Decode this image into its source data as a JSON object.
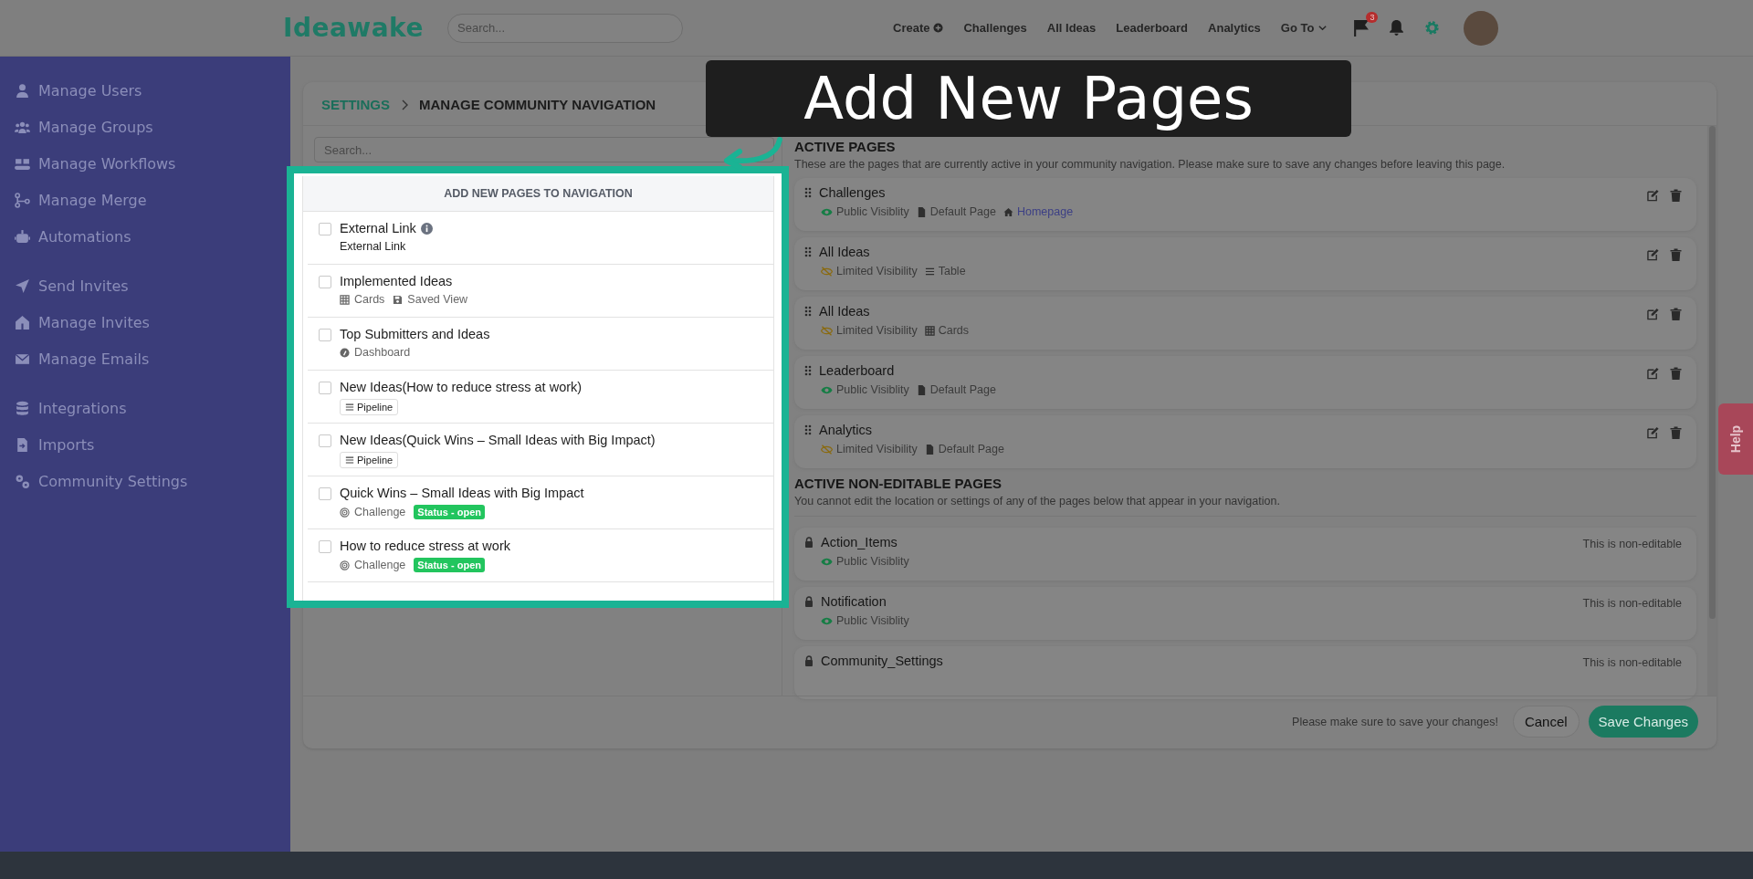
{
  "header": {
    "logo": "Ideawake",
    "search_placeholder": "Search...",
    "nav": [
      {
        "label": "Create",
        "kind": "create"
      },
      {
        "label": "Challenges",
        "kind": "link"
      },
      {
        "label": "All Ideas",
        "kind": "link"
      },
      {
        "label": "Leaderboard",
        "kind": "link"
      },
      {
        "label": "Analytics",
        "kind": "link"
      },
      {
        "label": "Go To",
        "kind": "dropdown"
      }
    ],
    "flag_badge": "3"
  },
  "sidebar": {
    "groups": [
      {
        "items": [
          {
            "label": "Manage Users"
          },
          {
            "label": "Manage Groups"
          },
          {
            "label": "Manage Workflows"
          },
          {
            "label": "Manage Merge"
          },
          {
            "label": "Automations"
          }
        ]
      },
      {
        "items": [
          {
            "label": "Send Invites"
          },
          {
            "label": "Manage Invites"
          },
          {
            "label": "Manage Emails"
          }
        ]
      },
      {
        "items": [
          {
            "label": "Integrations"
          },
          {
            "label": "Imports"
          },
          {
            "label": "Community Settings"
          }
        ]
      }
    ]
  },
  "breadcrumb": {
    "parent": "SETTINGS",
    "current": "MANAGE COMMUNITY NAVIGATION"
  },
  "add_pages": {
    "search_placeholder": "Search...",
    "title": "ADD NEW PAGES TO NAVIGATION",
    "items": [
      {
        "title": "External Link",
        "info": true,
        "checked": false,
        "meta": [
          {
            "kind": "text",
            "label": "External Link"
          }
        ]
      },
      {
        "title": "Implemented Ideas",
        "info": false,
        "checked": false,
        "meta": [
          {
            "kind": "cards",
            "label": "Cards"
          },
          {
            "kind": "saved-view",
            "label": "Saved View"
          }
        ]
      },
      {
        "title": "Top Submitters and Ideas",
        "info": false,
        "checked": false,
        "meta": [
          {
            "kind": "dashboard",
            "label": "Dashboard"
          }
        ]
      },
      {
        "title": "New Ideas(How to reduce stress at work)",
        "info": false,
        "checked": false,
        "meta": [
          {
            "kind": "pipeline",
            "label": "Pipeline"
          }
        ]
      },
      {
        "title": "New Ideas(Quick Wins – Small Ideas with Big Impact)",
        "info": false,
        "checked": false,
        "meta": [
          {
            "kind": "pipeline",
            "label": "Pipeline"
          }
        ]
      },
      {
        "title": "Quick Wins – Small Ideas with Big Impact",
        "info": false,
        "checked": false,
        "meta": [
          {
            "kind": "challenge",
            "label": "Challenge"
          },
          {
            "kind": "status",
            "label": "Status - open"
          }
        ]
      },
      {
        "title": "How to reduce stress at work",
        "info": false,
        "checked": false,
        "meta": [
          {
            "kind": "challenge",
            "label": "Challenge"
          },
          {
            "kind": "status",
            "label": "Status - open"
          }
        ]
      }
    ]
  },
  "active_pages": {
    "title": "ACTIVE PAGES",
    "description": "These are the pages that are currently active in your community navigation. Please make sure to save any changes before leaving this page.",
    "items": [
      {
        "name": "Challenges",
        "visibility": {
          "kind": "public",
          "label": "Public Visiblity"
        },
        "meta": [
          {
            "kind": "page",
            "label": "Default Page"
          },
          {
            "kind": "homepage",
            "label": "Homepage"
          }
        ]
      },
      {
        "name": "All Ideas",
        "visibility": {
          "kind": "limited",
          "label": "Limited Visibility"
        },
        "meta": [
          {
            "kind": "table",
            "label": "Table"
          }
        ]
      },
      {
        "name": "All Ideas",
        "visibility": {
          "kind": "limited",
          "label": "Limited Visibility"
        },
        "meta": [
          {
            "kind": "cards",
            "label": "Cards"
          }
        ]
      },
      {
        "name": "Leaderboard",
        "visibility": {
          "kind": "public",
          "label": "Public Visiblity"
        },
        "meta": [
          {
            "kind": "page",
            "label": "Default Page"
          }
        ]
      },
      {
        "name": "Analytics",
        "visibility": {
          "kind": "limited",
          "label": "Limited Visibility"
        },
        "meta": [
          {
            "kind": "page",
            "label": "Default Page"
          }
        ]
      }
    ]
  },
  "non_editable": {
    "title": "ACTIVE NON-EDITABLE PAGES",
    "description": "You cannot edit the location or settings of any of the pages below that appear in your navigation.",
    "items": [
      {
        "name": "Action_Items",
        "note": "This is non-editable",
        "visibility": {
          "kind": "public",
          "label": "Public Visiblity"
        }
      },
      {
        "name": "Notification",
        "note": "This is non-editable",
        "visibility": {
          "kind": "public",
          "label": "Public Visiblity"
        }
      },
      {
        "name": "Community_Settings",
        "note": "This is non-editable"
      }
    ]
  },
  "footer": {
    "note": "Please make sure to save your changes!",
    "cancel": "Cancel",
    "save": "Save Changes"
  },
  "help": "Help",
  "callout": "Add New Pages"
}
